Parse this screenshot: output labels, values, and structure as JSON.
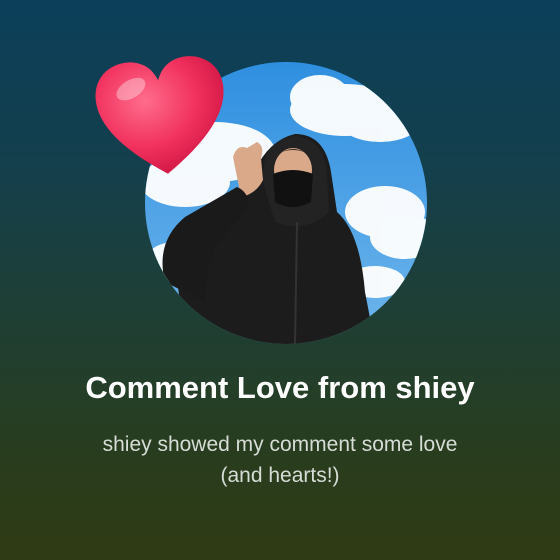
{
  "notification": {
    "title": "Comment Love from shiey",
    "message_line1": "shiey showed my comment some love",
    "message_line2": "(and hearts!)"
  },
  "icons": {
    "heart": "heart-icon",
    "avatar": "creator-avatar"
  },
  "colors": {
    "background_top": "#0b3f5a",
    "background_bottom": "#2f3b13",
    "heart": "#f0305c",
    "title": "#ffffff",
    "subtitle": "#d6dcd6"
  }
}
